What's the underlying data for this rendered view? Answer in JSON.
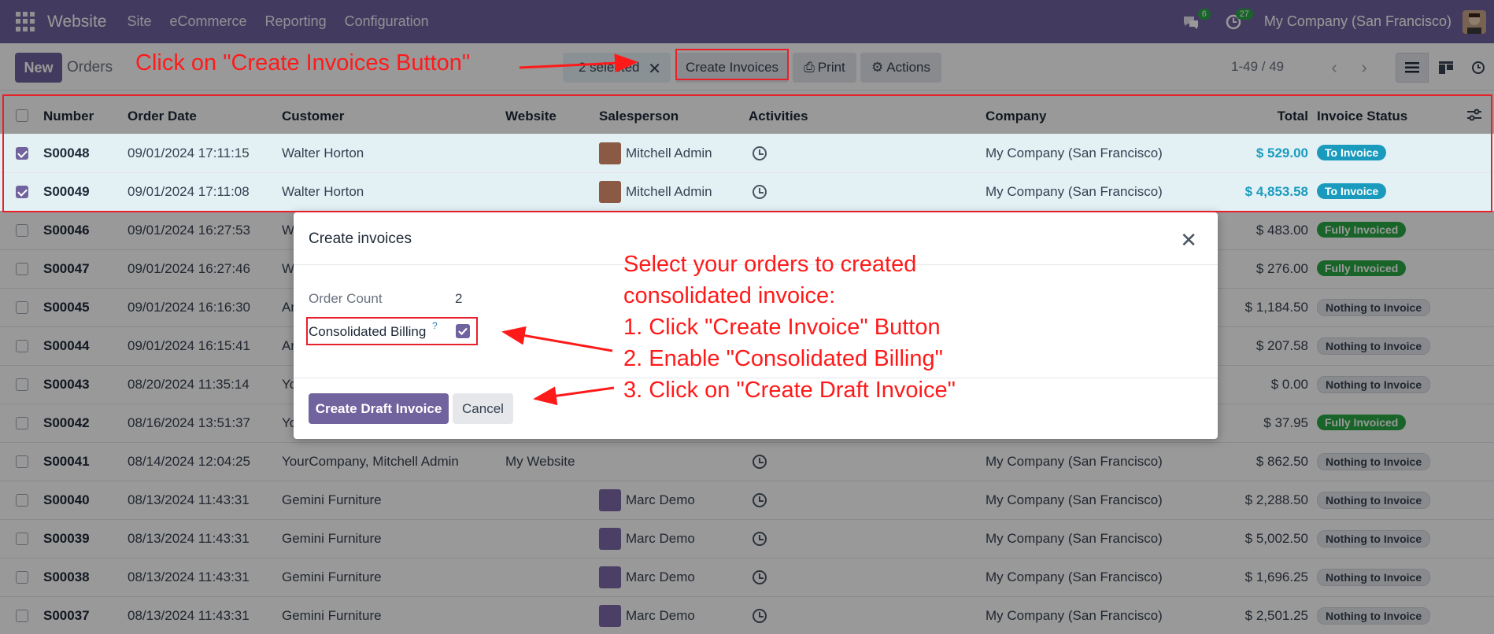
{
  "navbar": {
    "brand": "Website",
    "menu": [
      "Site",
      "eCommerce",
      "Reporting",
      "Configuration"
    ],
    "chat_count": "6",
    "activity_count": "27",
    "company": "My Company (San Francisco)"
  },
  "control": {
    "new_label": "New",
    "title": "Orders",
    "selected_label": "2 selected",
    "create_invoices_label": "Create Invoices",
    "print_label": "Print",
    "actions_label": "Actions",
    "pager": "1-49 / 49"
  },
  "table": {
    "headers": [
      "Number",
      "Order Date",
      "Customer",
      "Website",
      "Salesperson",
      "Activities",
      "Company",
      "Total",
      "Invoice Status"
    ],
    "rows": [
      {
        "number": "S00048",
        "date": "09/01/2024 17:11:15",
        "customer": "Walter Horton",
        "website": "",
        "salesperson": "Mitchell Admin",
        "company": "My Company (San Francisco)",
        "total": "$ 529.00",
        "status": "To Invoice",
        "selected": true
      },
      {
        "number": "S00049",
        "date": "09/01/2024 17:11:08",
        "customer": "Walter Horton",
        "website": "",
        "salesperson": "Mitchell Admin",
        "company": "My Company (San Francisco)",
        "total": "$ 4,853.58",
        "status": "To Invoice",
        "selected": true
      },
      {
        "number": "S00046",
        "date": "09/01/2024 16:27:53",
        "customer": "W",
        "website": "",
        "salesperson": "",
        "company": "",
        "total": "$ 483.00",
        "status": "Fully Invoiced",
        "selected": false
      },
      {
        "number": "S00047",
        "date": "09/01/2024 16:27:46",
        "customer": "W",
        "website": "",
        "salesperson": "",
        "company": "",
        "total": "$ 276.00",
        "status": "Fully Invoiced",
        "selected": false
      },
      {
        "number": "S00045",
        "date": "09/01/2024 16:16:30",
        "customer": "Ar",
        "website": "",
        "salesperson": "",
        "company": "",
        "total": "$ 1,184.50",
        "status": "Nothing to Invoice",
        "selected": false
      },
      {
        "number": "S00044",
        "date": "09/01/2024 16:15:41",
        "customer": "Ar",
        "website": "",
        "salesperson": "",
        "company": "",
        "total": "$ 207.58",
        "status": "Nothing to Invoice",
        "selected": false
      },
      {
        "number": "S00043",
        "date": "08/20/2024 11:35:14",
        "customer": "Yo",
        "website": "",
        "salesperson": "",
        "company": "",
        "total": "$ 0.00",
        "status": "Nothing to Invoice",
        "selected": false
      },
      {
        "number": "S00042",
        "date": "08/16/2024 13:51:37",
        "customer": "Yo",
        "website": "",
        "salesperson": "",
        "company": "",
        "total": "$ 37.95",
        "status": "Fully Invoiced",
        "selected": false
      },
      {
        "number": "S00041",
        "date": "08/14/2024 12:04:25",
        "customer": "YourCompany, Mitchell Admin",
        "website": "My Website",
        "salesperson": "",
        "company": "My Company (San Francisco)",
        "total": "$ 862.50",
        "status": "Nothing to Invoice",
        "selected": false
      },
      {
        "number": "S00040",
        "date": "08/13/2024 11:43:31",
        "customer": "Gemini Furniture",
        "website": "",
        "salesperson": "Marc Demo",
        "company": "My Company (San Francisco)",
        "total": "$ 2,288.50",
        "status": "Nothing to Invoice",
        "selected": false
      },
      {
        "number": "S00039",
        "date": "08/13/2024 11:43:31",
        "customer": "Gemini Furniture",
        "website": "",
        "salesperson": "Marc Demo",
        "company": "My Company (San Francisco)",
        "total": "$ 5,002.50",
        "status": "Nothing to Invoice",
        "selected": false
      },
      {
        "number": "S00038",
        "date": "08/13/2024 11:43:31",
        "customer": "Gemini Furniture",
        "website": "",
        "salesperson": "Marc Demo",
        "company": "My Company (San Francisco)",
        "total": "$ 1,696.25",
        "status": "Nothing to Invoice",
        "selected": false
      },
      {
        "number": "S00037",
        "date": "08/13/2024 11:43:31",
        "customer": "Gemini Furniture",
        "website": "",
        "salesperson": "Marc Demo",
        "company": "My Company (San Francisco)",
        "total": "$ 2,501.25",
        "status": "Nothing to Invoice",
        "selected": false
      }
    ]
  },
  "modal": {
    "title": "Create invoices",
    "order_count_label": "Order Count",
    "order_count_value": "2",
    "consolidated_label": "Consolidated Billing",
    "help_mark": "?",
    "create_draft_label": "Create Draft Invoice",
    "cancel_label": "Cancel"
  },
  "annotations": {
    "top_instruction": "Click on \"Create Invoices Button\"",
    "steps": [
      "Select your orders to created",
      "consolidated invoice:",
      "1. Click \"Create Invoice\" Button",
      "2. Enable \"Consolidated Billing\"",
      "3. Click on \"Create Draft Invoice\""
    ]
  },
  "colors": {
    "brand": "#71639e",
    "annotation": "#ff1a1a",
    "to_invoice": "#1a9bbd",
    "fully_invoiced": "#28a745"
  }
}
